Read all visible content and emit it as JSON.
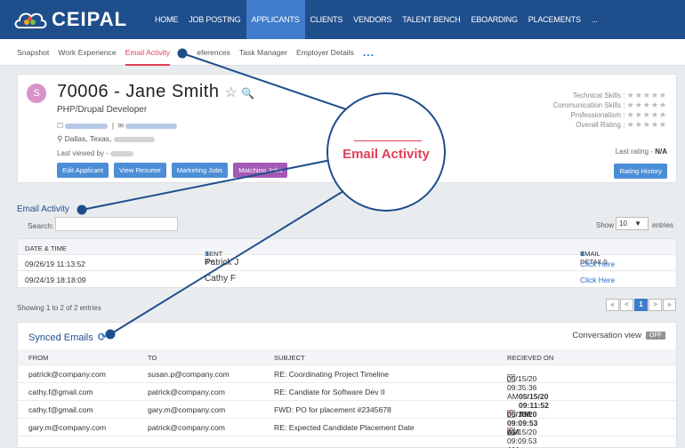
{
  "brand": {
    "name": "CEIPAL"
  },
  "nav": [
    {
      "label": "HOME"
    },
    {
      "label": "JOB POSTING"
    },
    {
      "label": "APPLICANTS"
    },
    {
      "label": "CLIENTS"
    },
    {
      "label": "VENDORS"
    },
    {
      "label": "TALENT BENCH"
    },
    {
      "label": "EBOARDING"
    },
    {
      "label": "PLACEMENTS"
    },
    {
      "label": "..."
    }
  ],
  "subtabs": [
    {
      "label": "Snapshot"
    },
    {
      "label": "Work Experience"
    },
    {
      "label": "Email Activity"
    },
    {
      "label": "eferences"
    },
    {
      "label": "Task Manager"
    },
    {
      "label": "Employer Details"
    }
  ],
  "subtabs_more": "...",
  "profile": {
    "avatar_letter": "S",
    "name": "70006 - Jane Smith",
    "star_icon": "☆",
    "search_icon": "🔍",
    "title": "PHP/Drupal Developer",
    "location": "Dallas, Texas,",
    "last_viewed_label": "Last viewed by -",
    "buttons": {
      "edit": "Edit Applicant",
      "resume": "View Resume",
      "marketing": "Marketing Jobs",
      "matching": "Matching Jobs"
    },
    "skills": [
      {
        "label": "Technical Skills :",
        "stars": "★★★★★"
      },
      {
        "label": "Communication Skills :",
        "stars": "★★★★★"
      },
      {
        "label": "Professionalism :",
        "stars": "★★★★★"
      },
      {
        "label": "Overall Rating :",
        "stars": "★★★★★"
      }
    ],
    "last_rating_label": "Last rating -",
    "last_rating_value": "N/A",
    "rating_history": "Rating History"
  },
  "email_activity": {
    "title": "Email Activity",
    "search_label": "Search:",
    "show_label": "Show",
    "show_value": "10",
    "entries_label": "entries",
    "headers": {
      "date": "DATE & TIME",
      "sent_by": "SENT BY",
      "details": "EMAIL DETAILS"
    },
    "rows": [
      {
        "date": "09/26/19 11:13:52",
        "sent_by": "Patrick J",
        "details": "Click Here"
      },
      {
        "date": "09/24/19 18:18:09",
        "sent_by": "Cathy F",
        "details": "Click Here"
      }
    ],
    "showing": "Showing 1 to 2 of 2 entries",
    "pager": {
      "first": "«",
      "prev": "<",
      "current": "1",
      "next": ">",
      "last": "»"
    }
  },
  "synced_emails": {
    "title": "Synced Emails",
    "conversation_view": "Conversation view",
    "toggle": "OFF",
    "headers": {
      "from": "FROM",
      "to": "TO",
      "subject": "SUBJECT",
      "received": "RECIEVED ON"
    },
    "rows": [
      {
        "from": "patrick@company.com",
        "to": "susan.p@company.com",
        "subject": "RE: Coordinating Project Timeline",
        "received": "05/15/20 09:35:36 AM",
        "bold": false,
        "icon": true
      },
      {
        "from": "cathy.f@gmail.com",
        "to": "patrick@company.com",
        "subject": "RE: Candiate for Software Dev II",
        "received": "05/15/20 09:11:52 AM",
        "bold": true,
        "icon": false
      },
      {
        "from": "cathy.f@gmail.com",
        "to": "gary.m@company.com",
        "subject": "FWD: PO for placement #2345678",
        "received": "05/15/20 09:09:53 AM",
        "bold": true,
        "icon": true
      },
      {
        "from": "gary.m@company.com",
        "to": "patrick@company.com",
        "subject": "RE: Expected Candidate Placement Date",
        "received": "05/15/20 09:09:53 AM",
        "bold": false,
        "icon": true
      }
    ]
  },
  "callout": {
    "label": "Email Activity"
  },
  "colors": {
    "topbar": "#1f4e8c",
    "accent": "#e0415a",
    "link": "#1f6fc4",
    "active_nav": "#3f7ccc"
  }
}
